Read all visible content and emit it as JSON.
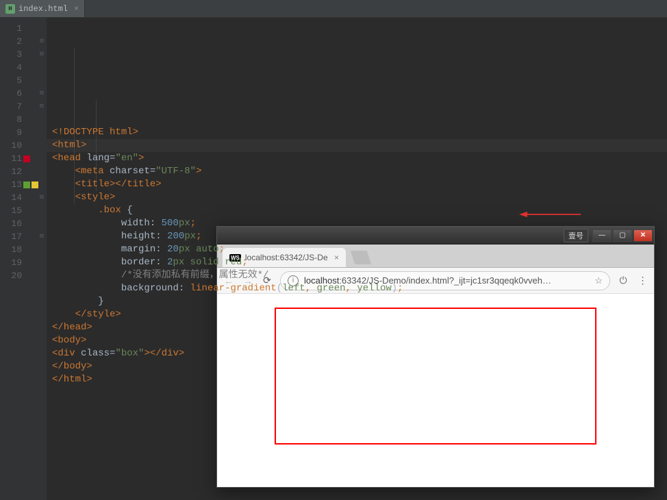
{
  "editor": {
    "tab": {
      "filename": "index.html"
    },
    "lines": [
      "1",
      "2",
      "3",
      "4",
      "5",
      "6",
      "7",
      "8",
      "9",
      "10",
      "11",
      "12",
      "13",
      "14",
      "15",
      "16",
      "17",
      "18",
      "19",
      "20"
    ]
  },
  "code": {
    "doctype_open": "<!",
    "doctype_name": "DOCTYPE",
    "doctype_space_html": " html",
    "doctype_close": ">",
    "html_open": "<html>",
    "head_open_name": "head",
    "head_attr_lang": "lang",
    "head_attr_lang_val": "\"en\"",
    "meta_name": "meta",
    "meta_attr_charset": "charset",
    "meta_attr_charset_val": "\"UTF-8\"",
    "title_open": "<title>",
    "title_close": "</title>",
    "style_open": "<style>",
    "style_close": "</style>",
    "selector_box": ".box ",
    "brace_open": "{",
    "brace_close": "}",
    "prop_width": "width",
    "val_width_num": "500",
    "val_width_unit": "px",
    "prop_height": "height",
    "val_height_num": "200",
    "val_height_unit": "px",
    "prop_margin": "margin",
    "val_margin_num": "20",
    "val_margin_unit": "px",
    "val_margin_auto": " auto",
    "prop_border": "border",
    "val_border_num": "2",
    "val_border_unit": "px",
    "val_border_solid": " solid",
    "val_border_red": " red",
    "comment_line": "/*没有添加私有前缀，属性无效*/",
    "prop_bg": "background",
    "val_bg_func": "linear-gradient",
    "val_bg_args_left": "left",
    "val_bg_args_green": "green",
    "val_bg_args_yellow": "yellow",
    "head_close": "</head>",
    "body_open": "<body>",
    "div_name": "div",
    "div_attr_class": "class",
    "div_attr_class_val": "\"box\"",
    "body_close": "</body>",
    "html_close": "</html>",
    "colon": ":",
    "semi": ";",
    "comma": ", ",
    "paren_open": "(",
    "paren_close": ")",
    "lt": "<",
    "gt": ">",
    "slash": "/",
    "eq": "="
  },
  "browser": {
    "window_label": "壹号",
    "tab_title": "localhost:63342/JS-De",
    "url_host": "localhost",
    "url_rest": ":63342/JS-Demo/index.html?_ijt=jc1sr3qqeqk0vveh…"
  }
}
